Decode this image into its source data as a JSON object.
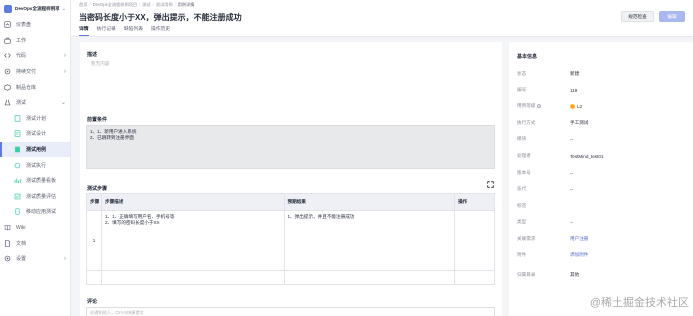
{
  "project": {
    "name": "DevOps全流程样例项目"
  },
  "sidebar": {
    "items": [
      {
        "label": "仪表盘",
        "icon": "dashboard-icon",
        "arrow": ""
      },
      {
        "label": "工作",
        "icon": "work-icon",
        "arrow": ""
      },
      {
        "label": "代码",
        "icon": "code-icon",
        "arrow": "›"
      },
      {
        "label": "持续交付",
        "icon": "delivery-icon",
        "arrow": "›"
      },
      {
        "label": "制品仓库",
        "icon": "artifact-icon",
        "arrow": ""
      },
      {
        "label": "测试",
        "icon": "test-icon",
        "arrow": "⌄"
      },
      {
        "label": "测试计划",
        "icon": "test-plan-icon",
        "arrow": ""
      },
      {
        "label": "测试设计",
        "icon": "test-design-icon",
        "arrow": ""
      },
      {
        "label": "测试用例",
        "icon": "test-case-icon",
        "arrow": ""
      },
      {
        "label": "测试执行",
        "icon": "test-execute-icon",
        "arrow": ""
      },
      {
        "label": "测试质量看板",
        "icon": "quality-board-icon",
        "arrow": ""
      },
      {
        "label": "测试质量评估",
        "icon": "quality-assess-icon",
        "arrow": ""
      },
      {
        "label": "移动应用测试",
        "icon": "mobile-test-icon",
        "arrow": ""
      },
      {
        "label": "Wiki",
        "icon": "wiki-icon",
        "arrow": ""
      },
      {
        "label": "文档",
        "icon": "docs-icon",
        "arrow": ""
      },
      {
        "label": "设置",
        "icon": "settings-icon",
        "arrow": "›"
      }
    ]
  },
  "breadcrumb": [
    "首页",
    "DevOps全流程样例项目",
    "测试",
    "测试用例",
    "用例详情"
  ],
  "page_title": "当密码长度小于XX，弹出提示，不能注册成功",
  "header_buttons": {
    "close_label": "规范检查",
    "edit_label": "编辑"
  },
  "tabs": [
    "详情",
    "执行记录",
    "缺陷列表",
    "操作历史"
  ],
  "main": {
    "description_title": "描述",
    "description_placeholder": "暂无内容",
    "precondition_title": "前置条件",
    "preconditions": [
      "1、1、新用户进入系统",
      "2、已跳转到注册界面"
    ],
    "steps_title": "测试步骤",
    "steps_columns": [
      "步骤",
      "步骤描述",
      "预期结果",
      "操作"
    ],
    "steps_rows": [
      {
        "index": "1",
        "description": [
          "1、1、正确填写用户名、手机号等",
          "2、填写的密码长度小于XX"
        ],
        "expected": "1、弹出提示，并且不能注册成功",
        "action": ""
      },
      {
        "index": "",
        "description": [
          ""
        ],
        "expected": "",
        "action": ""
      }
    ],
    "comment_title": "评论",
    "comment_placeholder": "@通知他人，Ctrl+S快捷提交"
  },
  "side": {
    "title": "基本信息",
    "fields": [
      {
        "label": "状态",
        "value": "新建"
      },
      {
        "label": "编号",
        "value": "119"
      },
      {
        "label": "用例等级",
        "value": "L2"
      },
      {
        "label": "执行方式",
        "value": "手工测试"
      },
      {
        "label": "模块",
        "value": "--"
      },
      {
        "label": "处理者",
        "value": "TestMind_test01"
      },
      {
        "label": "版本号",
        "value": "--"
      },
      {
        "label": "迭代",
        "value": "--"
      },
      {
        "label": "标签",
        "value": ""
      },
      {
        "label": "类型",
        "value": "--"
      },
      {
        "label": "关联需求",
        "value": "用户注册"
      },
      {
        "label": "附件",
        "value": "添加附件"
      },
      {
        "label": "归属目录",
        "value": "其他"
      }
    ]
  },
  "watermark": "@稀土掘金技术社区",
  "colors": {
    "primary": "#5e7ce0",
    "link": "#526ecc",
    "level_dot": "#fa9841"
  }
}
